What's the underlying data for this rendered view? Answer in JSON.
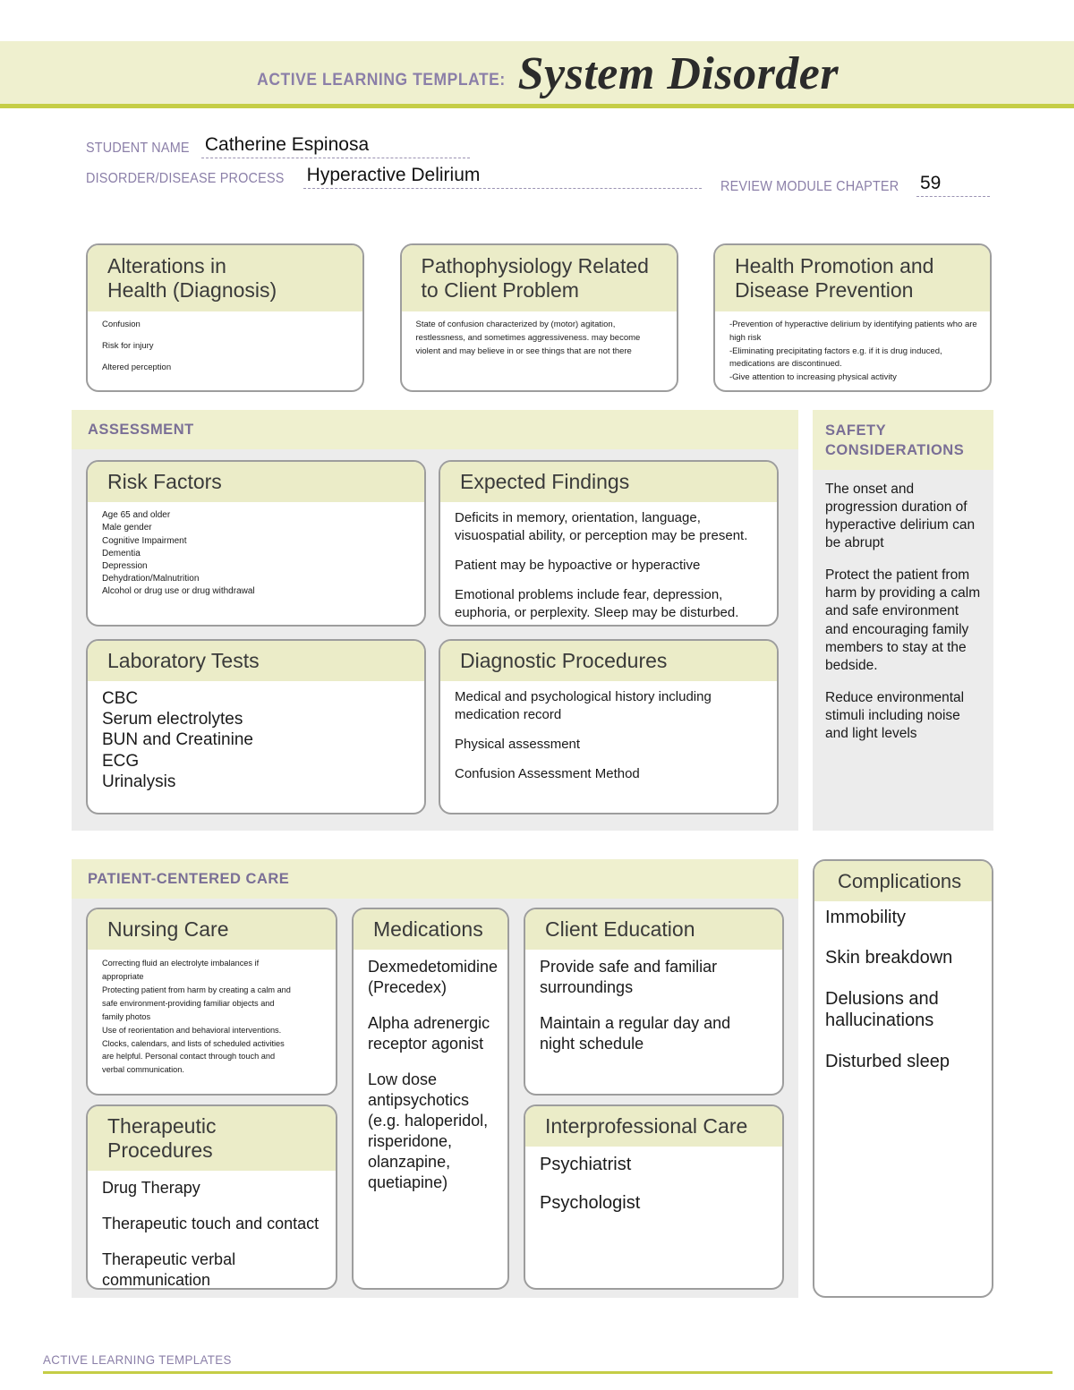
{
  "header": {
    "kicker": "ACTIVE LEARNING TEMPLATE:",
    "title": "System Disorder",
    "band_color": "#eff0cf",
    "rule_color": "#c5cd46",
    "label_color": "#8b7fa8"
  },
  "identity": {
    "student_name_label": "STUDENT NAME",
    "student_name_value": "Catherine Espinosa",
    "disorder_label": "DISORDER/DISEASE PROCESS",
    "disorder_value": "Hyperactive Delirium",
    "chapter_label": "REVIEW MODULE CHAPTER",
    "chapter_value": "59"
  },
  "top_cards": [
    {
      "title": "Alterations in\nHealth (Diagnosis)",
      "lines": [
        "Confusion",
        "Risk for injury",
        "Altered perception"
      ]
    },
    {
      "title": "Pathophysiology Related\nto Client Problem",
      "body": "State of confusion characterized by (motor) agitation, restlessness, and sometimes aggressiveness. may become violent and may believe in or see things that are not there"
    },
    {
      "title": "Health Promotion and\nDisease Prevention",
      "lines": [
        "-Prevention of hyperactive delirium by identifying patients who are high risk",
        "-Eliminating precipitating factors e.g. if it is drug induced, medications are discontinued.",
        "-Give attention to increasing physical activity"
      ]
    }
  ],
  "assessment": {
    "section_title": "ASSESSMENT",
    "risk_factors": {
      "title": "Risk Factors",
      "items": [
        "Age 65 and older",
        "Male gender",
        "Cognitive Impairment",
        "Dementia",
        "Depression",
        "Dehydration/Malnutrition",
        "Alcohol or drug use or drug withdrawal"
      ]
    },
    "expected_findings": {
      "title": "Expected Findings",
      "paragraphs": [
        "Deficits in memory, orientation, language, visuospatial ability, or perception may be present.",
        "Patient may be hypoactive or hyperactive",
        "Emotional problems include fear, depression, euphoria, or perplexity. Sleep may be disturbed."
      ]
    },
    "laboratory_tests": {
      "title": "Laboratory Tests",
      "items": [
        "CBC",
        "Serum electrolytes",
        "BUN and Creatinine",
        "ECG",
        "Urinalysis"
      ]
    },
    "diagnostic_procedures": {
      "title": "Diagnostic Procedures",
      "paragraphs": [
        "Medical and psychological history including medication record",
        "Physical assessment",
        "Confusion Assessment Method"
      ]
    }
  },
  "safety": {
    "section_title": "SAFETY CONSIDERATIONS",
    "paragraphs": [
      "The onset and progression duration of hyperactive delirium can be abrupt",
      "Protect the patient from harm by providing a calm and safe environment and encouraging family members to stay at the bedside.",
      "Reduce environmental stimuli including noise and light levels"
    ]
  },
  "patient_centered_care": {
    "section_title": "PATIENT-CENTERED CARE",
    "nursing_care": {
      "title": "Nursing Care",
      "lines": [
        "Correcting fluid an electrolyte imbalances if",
        "appropriate",
        "Protecting patient from harm by creating a calm and",
        "safe environment-providing familiar objects and",
        "family photos",
        "Use of reorientation and behavioral interventions.",
        "Clocks, calendars, and lists of scheduled activities",
        "are helpful. Personal contact through touch and",
        "verbal communication."
      ]
    },
    "therapeutic_procedures": {
      "title": "Therapeutic Procedures",
      "paragraphs": [
        "Drug Therapy",
        "Therapeutic touch and contact",
        "Therapeutic verbal communication"
      ]
    },
    "medications": {
      "title": "Medications",
      "paragraphs": [
        "Dexmedetomidine (Precedex)",
        "Alpha adrenergic receptor agonist",
        "Low dose antipsychotics (e.g. haloperidol, risperidone, olanzapine, quetiapine)"
      ]
    },
    "client_education": {
      "title": "Client Education",
      "paragraphs": [
        "Provide safe and familiar surroundings",
        "Maintain a regular day and night schedule"
      ]
    },
    "interprofessional_care": {
      "title": "Interprofessional Care",
      "paragraphs": [
        "Psychiatrist",
        "Psychologist"
      ]
    }
  },
  "complications": {
    "title": "Complications",
    "items": [
      "Immobility",
      "Skin breakdown",
      "Delusions and hallucinations",
      "Disturbed sleep"
    ]
  },
  "footer": {
    "text": "ACTIVE LEARNING TEMPLATES"
  }
}
